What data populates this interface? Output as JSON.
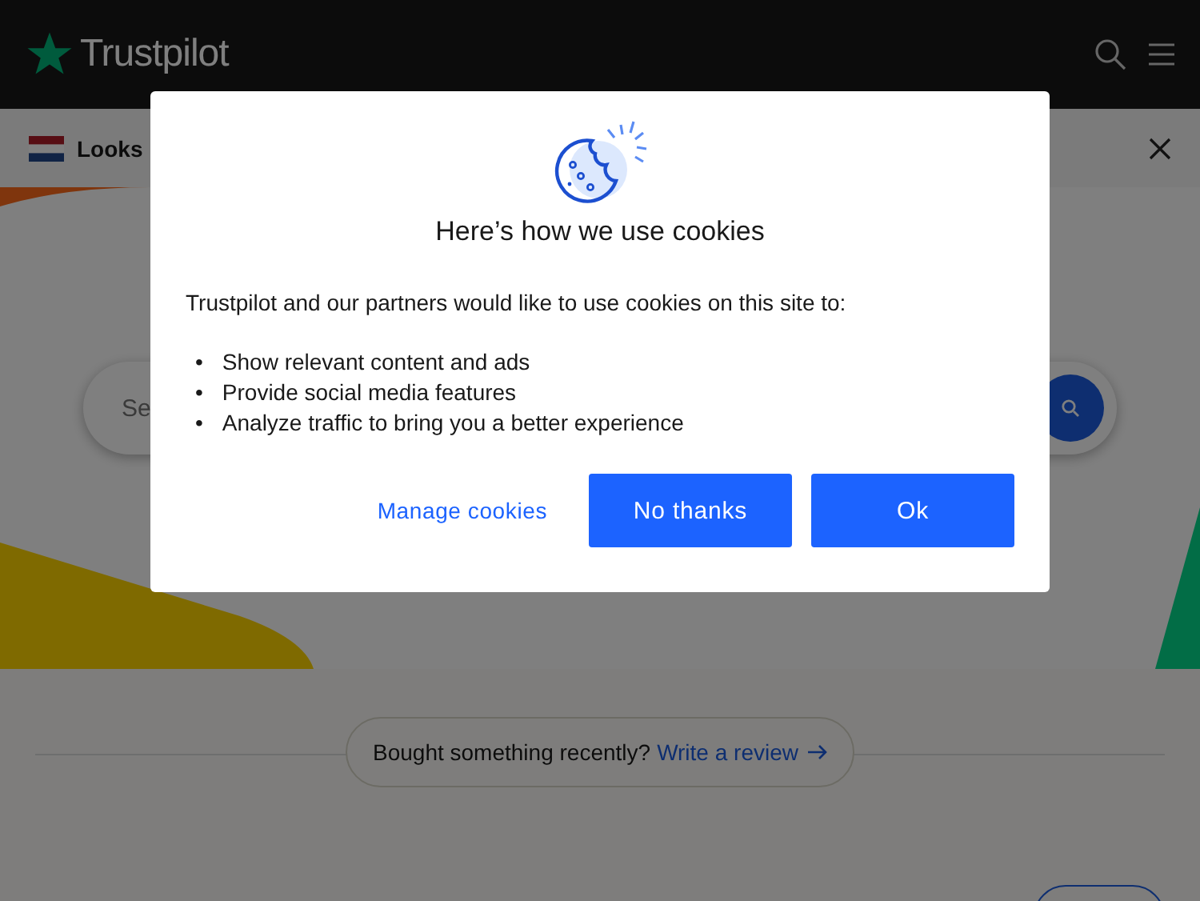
{
  "header": {
    "logo": "Trustpilot"
  },
  "banner": {
    "text": "Looks"
  },
  "search": {
    "placeholder": "Se"
  },
  "review_prompt": {
    "text": "Bought something recently?",
    "link": "Write a review"
  },
  "cookie_dialog": {
    "title": "Here’s how we use cookies",
    "intro": "Trustpilot and our partners would like to use cookies on this site to:",
    "items": [
      {
        "bullet": "•",
        "text": "Show relevant content and ads"
      },
      {
        "bullet": "•",
        "text": "Provide social media features"
      },
      {
        "bullet": "•",
        "text": "Analyze traffic to bring you a better experience"
      }
    ],
    "buttons": [
      {
        "label": "Manage cookies",
        "kind": "link"
      },
      {
        "label": "No thanks",
        "kind": "primary"
      },
      {
        "label": "Ok",
        "kind": "primary"
      }
    ]
  }
}
